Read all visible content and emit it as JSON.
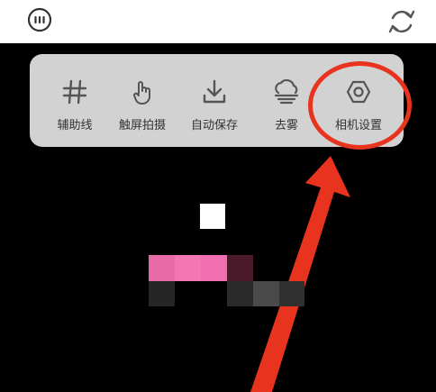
{
  "menu": {
    "items": [
      {
        "label": "辅助线",
        "icon": "grid-icon"
      },
      {
        "label": "触屏拍摄",
        "icon": "touch-icon"
      },
      {
        "label": "自动保存",
        "icon": "download-icon"
      },
      {
        "label": "去雾",
        "icon": "cloud-icon"
      },
      {
        "label": "相机设置",
        "icon": "hexagon-settings-icon"
      }
    ]
  },
  "colors": {
    "panel": "#d2d2d2",
    "annotation": "#e8331f",
    "icon": "#555555"
  }
}
